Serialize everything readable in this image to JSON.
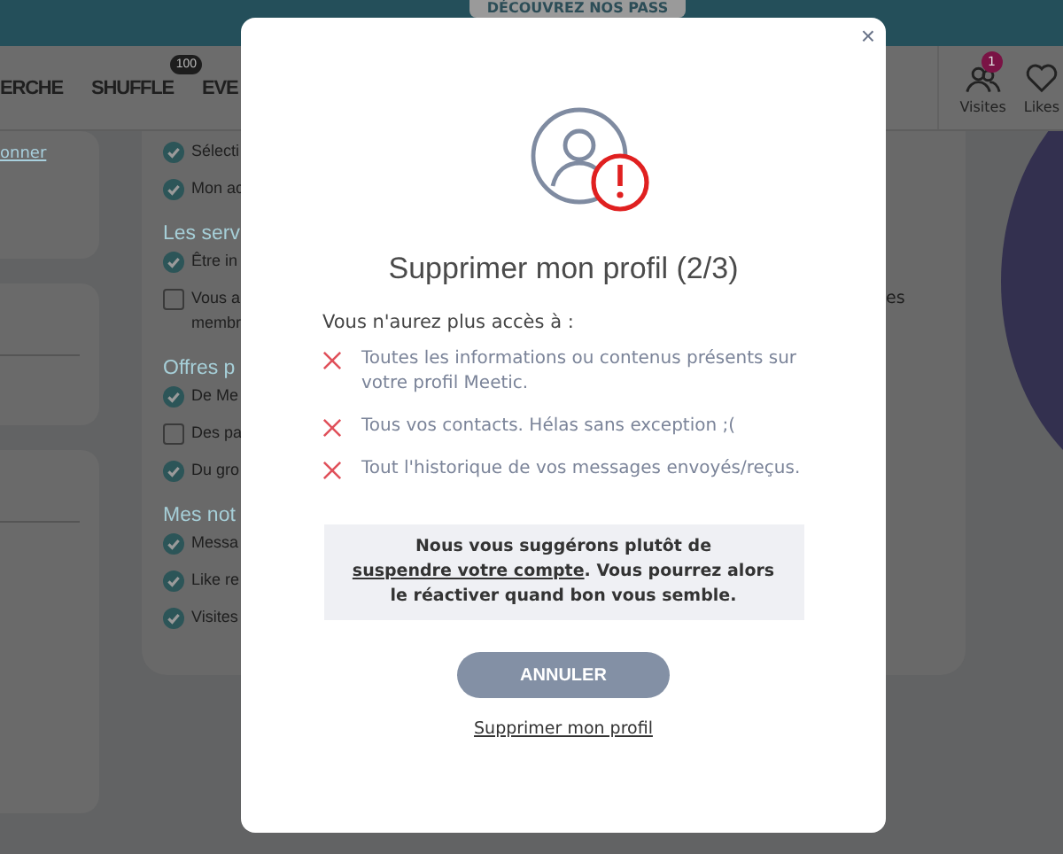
{
  "banner": {
    "promo": "DÉCOUVREZ NOS PASS"
  },
  "nav": {
    "items": [
      {
        "label": "ERCHE"
      },
      {
        "label": "SHUFFLE",
        "badge": "100"
      },
      {
        "label": "EVE"
      }
    ],
    "actions": [
      {
        "kind": "visits",
        "label": "Visites",
        "badge": "1"
      },
      {
        "kind": "likes",
        "label": "Likes"
      }
    ]
  },
  "left_card": {
    "link": "onner"
  },
  "settings": [
    {
      "kind": "item",
      "label": "Sélecti",
      "checked": true
    },
    {
      "kind": "item",
      "label": "Mon ac",
      "checked": true
    },
    {
      "kind": "heading",
      "label": "Les serv"
    },
    {
      "kind": "item",
      "label": "Être in",
      "checked": true
    },
    {
      "kind": "item",
      "label": "Vous a",
      "label2": "membr",
      "checked": false
    },
    {
      "kind": "heading",
      "label": "Offres p"
    },
    {
      "kind": "item",
      "label": "De Me",
      "checked": true
    },
    {
      "kind": "item",
      "label": "Des pa",
      "checked": false
    },
    {
      "kind": "item",
      "label": "Du gro",
      "checked": true
    },
    {
      "kind": "heading",
      "label": "Mes not"
    },
    {
      "kind": "item",
      "label": "Messa",
      "checked": true
    },
    {
      "kind": "item",
      "label": "Like re",
      "checked": true
    },
    {
      "kind": "item",
      "label": "Visites",
      "checked": true
    }
  ],
  "settings_overflow": "es",
  "modal": {
    "close": "×",
    "title": "Supprimer mon profil (2/3)",
    "intro": "Vous n'aurez plus accès à :",
    "losses": [
      "Toutes les informations ou contenus présents sur votre profil Meetic.",
      "Tous vos contacts. Hélas sans exception ;(",
      "Tout l'historique de vos messages envoyés/reçus."
    ],
    "suggestion": {
      "before": "Nous vous suggérons plutôt de ",
      "link": "suspendre votre compte",
      "after": ". Vous pourrez alors le réactiver quand bon vous semble."
    },
    "cancel_button": "ANNULER",
    "delete_link": "Supprimer mon profil"
  }
}
